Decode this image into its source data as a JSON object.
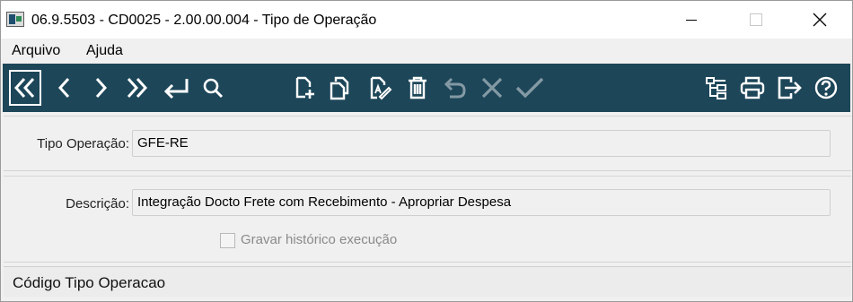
{
  "window": {
    "title": "06.9.5503 - CD0025 - 2.00.00.004 - Tipo de Operação",
    "controls": {
      "minimize": "minimize",
      "maximize": "maximize",
      "close": "close"
    }
  },
  "menu": {
    "items": [
      {
        "label": "Arquivo"
      },
      {
        "label": "Ajuda"
      }
    ]
  },
  "toolbar": {
    "background": "#1d4659",
    "icon_color": "#ffffff",
    "buttons": [
      {
        "name": "first-record",
        "icon": "double-chevron-left-icon"
      },
      {
        "name": "previous-record",
        "icon": "chevron-left-icon"
      },
      {
        "name": "next-record",
        "icon": "chevron-right-icon"
      },
      {
        "name": "last-record",
        "icon": "double-chevron-right-icon"
      },
      {
        "name": "goto-record",
        "icon": "return-arrow-icon"
      },
      {
        "name": "search",
        "icon": "search-icon"
      },
      {
        "name": "new-record",
        "icon": "new-document-icon"
      },
      {
        "name": "copy-record",
        "icon": "copy-icon"
      },
      {
        "name": "edit-record",
        "icon": "edit-document-icon"
      },
      {
        "name": "delete-record",
        "icon": "trash-icon"
      },
      {
        "name": "undo",
        "icon": "undo-icon",
        "disabled": true
      },
      {
        "name": "cancel",
        "icon": "close-icon",
        "disabled": true
      },
      {
        "name": "save",
        "icon": "check-icon",
        "disabled": true
      },
      {
        "name": "hierarchy",
        "icon": "tree-icon"
      },
      {
        "name": "print",
        "icon": "printer-icon"
      },
      {
        "name": "exit",
        "icon": "exit-icon"
      },
      {
        "name": "help",
        "icon": "help-icon"
      }
    ]
  },
  "form": {
    "tipo_operacao": {
      "label": "Tipo Operação:",
      "value": "GFE-RE"
    },
    "descricao": {
      "label": "Descrição:",
      "value": "Integração Docto Frete com Recebimento - Apropriar Despesa"
    },
    "gravar_historico": {
      "label": "Gravar histórico execução",
      "checked": false,
      "enabled": false
    }
  },
  "status_bar": {
    "text": "Código Tipo Operacao"
  }
}
